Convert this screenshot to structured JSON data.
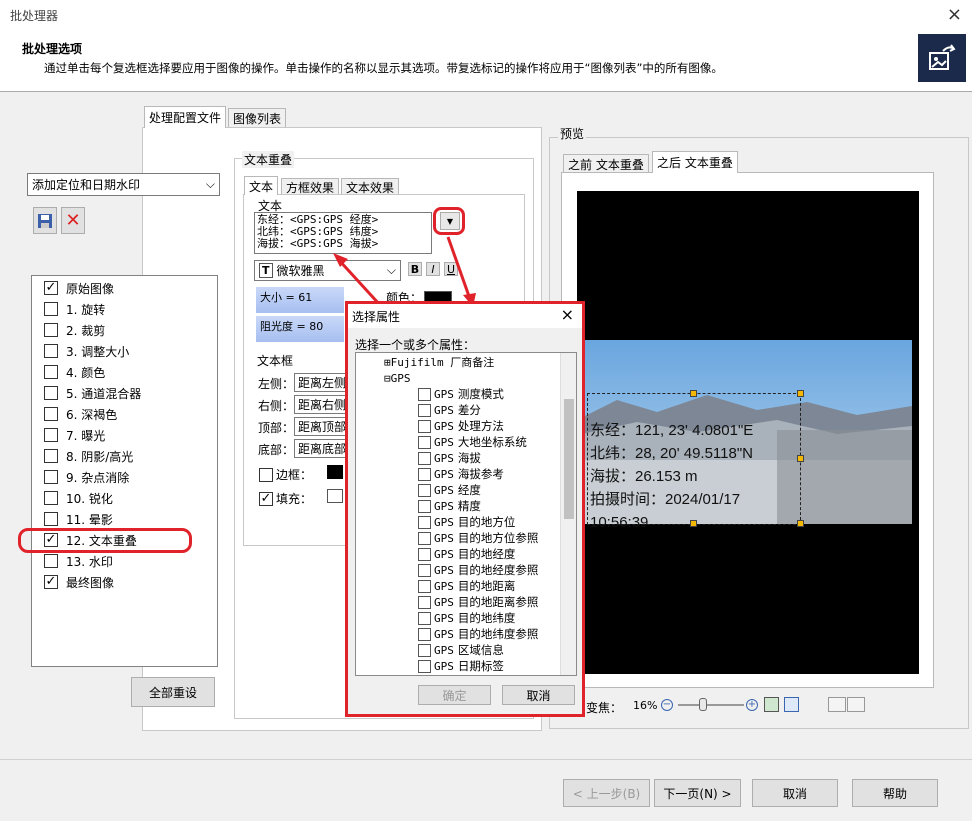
{
  "window": {
    "title": "批处理器",
    "close": "×"
  },
  "header": {
    "title": "批处理选项",
    "desc": "通过单击每个复选框选择要应用于图像的操作。单击操作的名称以显示其选项。带复选标记的操作将应用于“图像列表”中的所有图像。"
  },
  "tabs": {
    "profile": "处理配置文件",
    "image_list": "图像列表"
  },
  "profile": {
    "selected": "添加定位和日期水印"
  },
  "ops": [
    {
      "label": "原始图像",
      "checked": true
    },
    {
      "label": "1. 旋转",
      "checked": false
    },
    {
      "label": "2. 裁剪",
      "checked": false
    },
    {
      "label": "3. 调整大小",
      "checked": false
    },
    {
      "label": "4. 颜色",
      "checked": false
    },
    {
      "label": "5. 通道混合器",
      "checked": false
    },
    {
      "label": "6. 深褐色",
      "checked": false
    },
    {
      "label": "7. 曝光",
      "checked": false
    },
    {
      "label": "8. 阴影/高光",
      "checked": false
    },
    {
      "label": "9. 杂点消除",
      "checked": false
    },
    {
      "label": "10. 锐化",
      "checked": false
    },
    {
      "label": "11. 晕影",
      "checked": false
    },
    {
      "label": "12. 文本重叠",
      "checked": true
    },
    {
      "label": "13. 水印",
      "checked": false
    },
    {
      "label": "最终图像",
      "checked": true
    }
  ],
  "reset_all": "全部重设",
  "overlay": {
    "group": "文本重叠",
    "tabs": [
      "文本",
      "方框效果",
      "文本效果"
    ],
    "text_group": "文本",
    "lines": [
      "东经：<GPS:GPS 经度>",
      "北纬：<GPS:GPS 纬度>",
      "海拔：<GPS:GPS 海拔>"
    ],
    "font": "微软雅黑",
    "bold": "B",
    "italic": "I",
    "underline": "U",
    "size_label": "大小 = 61",
    "opacity_label": "阻光度 = 80",
    "color_label": "颜色：",
    "box_group": "文本框",
    "left": "左侧：",
    "right": "右侧：",
    "top": "顶部：",
    "bottom": "底部：",
    "left_val": "距离左侧",
    "right_val": "距离右侧",
    "top_val": "距离顶部",
    "bottom_val": "距离底部",
    "border": "边框：",
    "fill": "填充："
  },
  "preview": {
    "label": "预览",
    "tab_before": "之前 文本重叠",
    "tab_after": "之后 文本重叠",
    "zoom_label": "变焦：",
    "zoom_value": "16%",
    "overlay_lines": [
      "东经：121, 23' 4.0801\"E",
      "北纬：28, 20' 49.5118\"N",
      "海拔：26.153 m",
      "拍摄时间：2024/01/17",
      "10:56:39"
    ]
  },
  "dialog": {
    "title": "选择属性",
    "close": "×",
    "prompt": "选择一个或多个属性：",
    "groups": [
      {
        "name": "Fujifilm 厂商备注"
      },
      {
        "name": "GPS"
      }
    ],
    "items": [
      {
        "prefix": "GPS",
        "label": "测度模式"
      },
      {
        "prefix": "GPS",
        "label": "差分"
      },
      {
        "prefix": "GPS",
        "label": "处理方法"
      },
      {
        "prefix": "GPS",
        "label": "大地坐标系统"
      },
      {
        "prefix": "GPS",
        "label": "海拔"
      },
      {
        "prefix": "GPS",
        "label": "海拔参考"
      },
      {
        "prefix": "GPS",
        "label": "经度"
      },
      {
        "prefix": "GPS",
        "label": "精度"
      },
      {
        "prefix": "GPS",
        "label": "目的地方位"
      },
      {
        "prefix": "GPS",
        "label": "目的地方位参照"
      },
      {
        "prefix": "GPS",
        "label": "目的地经度"
      },
      {
        "prefix": "GPS",
        "label": "目的地经度参照"
      },
      {
        "prefix": "GPS",
        "label": "目的地距离"
      },
      {
        "prefix": "GPS",
        "label": "目的地距离参照"
      },
      {
        "prefix": "GPS",
        "label": "目的地纬度"
      },
      {
        "prefix": "GPS",
        "label": "目的地纬度参照"
      },
      {
        "prefix": "GPS",
        "label": "区域信息"
      },
      {
        "prefix": "GPS",
        "label": "日期标签"
      }
    ],
    "ok": "确定",
    "cancel": "取消"
  },
  "footer": {
    "prev": "< 上一步(B)",
    "next": "下一页(N) >",
    "cancel": "取消",
    "help": "帮助"
  }
}
